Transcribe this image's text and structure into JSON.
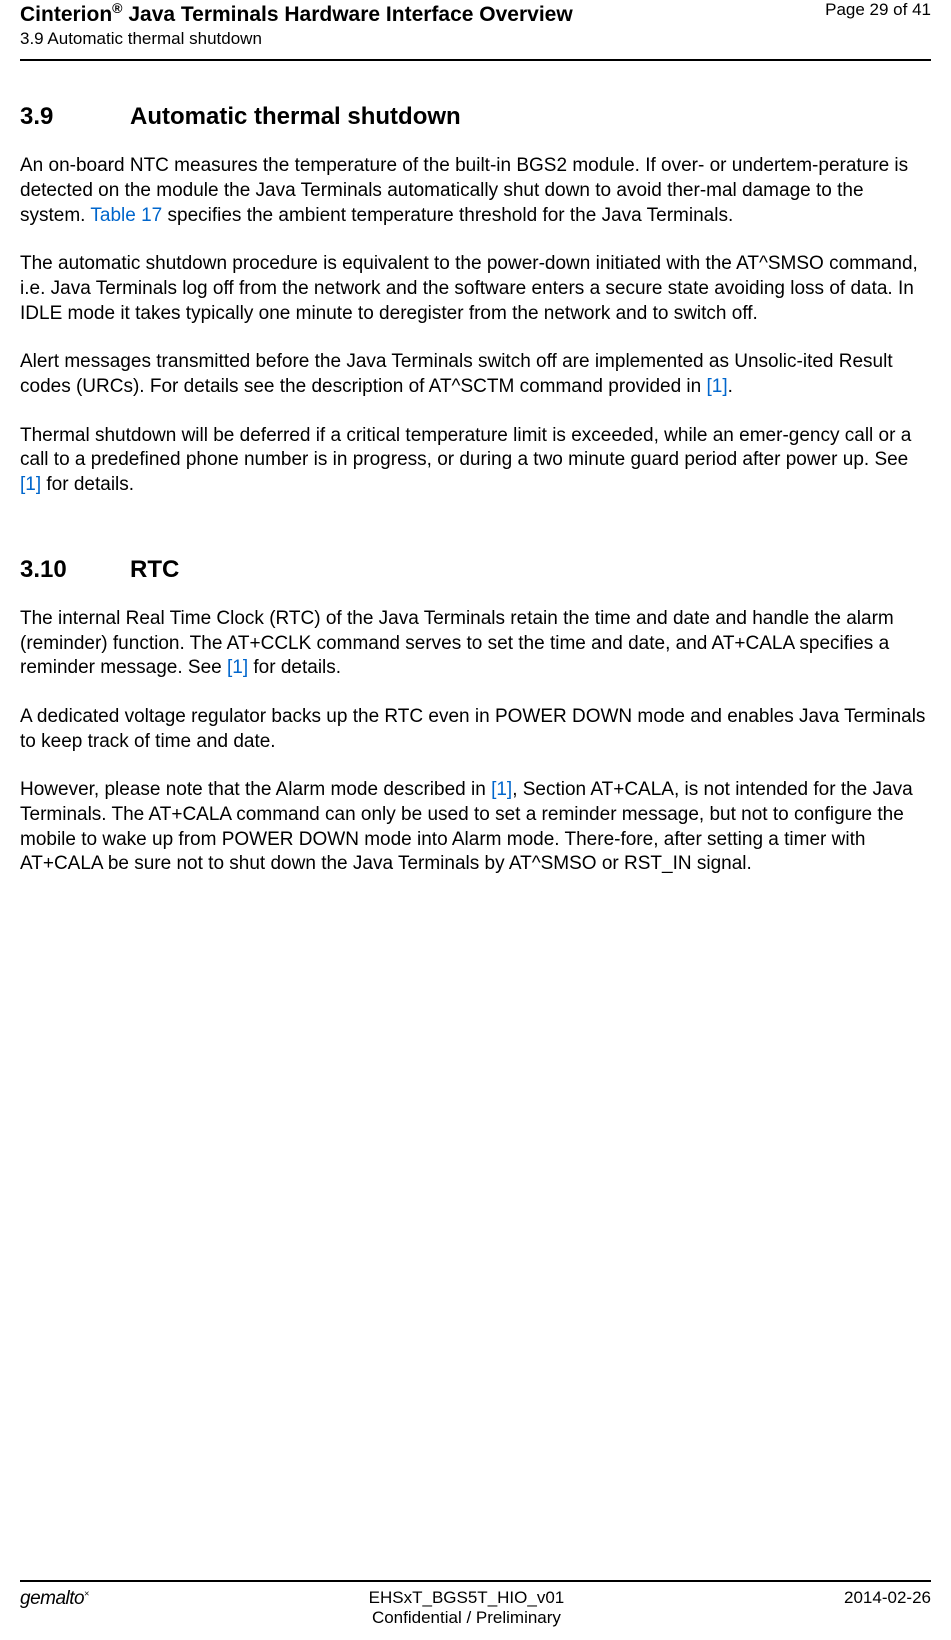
{
  "header": {
    "title_prefix": "Cinterion",
    "title_suffix": " Java Terminals Hardware Interface Overview",
    "subtitle": "3.9 Automatic thermal shutdown",
    "page_number": "Page 29 of 41"
  },
  "section1": {
    "number": "3.9",
    "title": "Automatic thermal shutdown",
    "p1a": "An on-board NTC measures the temperature of the built-in BGS2 module. If over- or undertem-perature is detected on the module the Java Terminals automatically shut down to avoid ther-mal damage to the system. ",
    "p1_link": "Table 17",
    "p1b": " specifies the ambient temperature threshold for the Java Terminals.",
    "p2": "The automatic shutdown procedure is equivalent to the power-down initiated with the AT^SMSO command, i.e. Java Terminals log off from the network and the software enters a secure state avoiding loss of data. In IDLE mode it takes typically one minute to deregister from the network and to switch off.",
    "p3a": "Alert messages transmitted before the Java Terminals switch off are implemented as Unsolic-ited Result codes (URCs). For details see the description of AT^SCTM command provided in ",
    "p3_link": "[1]",
    "p3b": ".",
    "p4a": "Thermal shutdown will be deferred if a critical temperature limit is exceeded, while an emer-gency call or a call to a predefined phone number is in progress, or during a two minute guard period after power up. See ",
    "p4_link": "[1]",
    "p4b": " for details."
  },
  "section2": {
    "number": "3.10",
    "title": "RTC",
    "p1a": "The internal Real Time Clock (RTC) of the Java Terminals retain the time and date and handle the alarm (reminder) function. The AT+CCLK command serves to set the time and date, and AT+CALA specifies a reminder message. See ",
    "p1_link": "[1]",
    "p1b": " for details.",
    "p2": "A dedicated voltage regulator backs up the RTC even in POWER DOWN mode and enables Java Terminals to keep track of time and date.",
    "p3a": "However, please note that the Alarm mode described in ",
    "p3_link": "[1]",
    "p3b": ", Section AT+CALA, is not intended for the Java Terminals. The AT+CALA command can only be used to set a reminder message, but not to configure the mobile to wake up from POWER DOWN mode into Alarm mode. There-fore, after setting a timer with AT+CALA be sure not to shut down the Java Terminals by AT^SMSO or RST_IN signal."
  },
  "footer": {
    "logo": "gemalto",
    "logo_sup": "×",
    "center_line1": "EHSxT_BGS5T_HIO_v01",
    "center_line2": "Confidential / Preliminary",
    "date": "2014-02-26"
  }
}
